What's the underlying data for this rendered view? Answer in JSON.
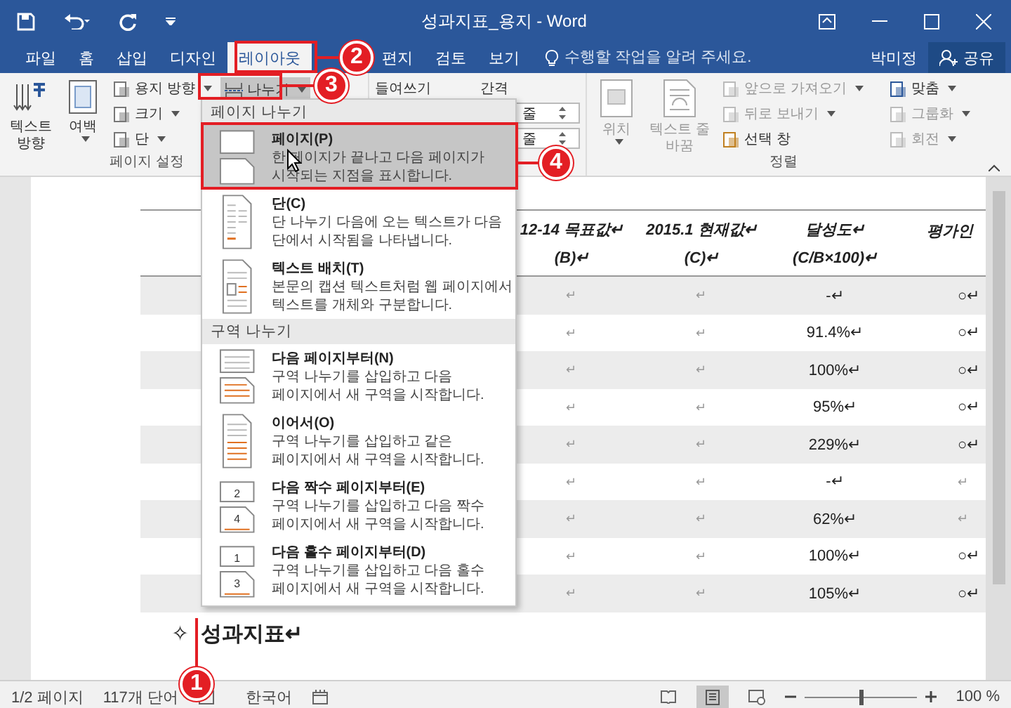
{
  "window": {
    "title": "성과지표_용지 - Word"
  },
  "tabs": [
    {
      "label": "파일",
      "selected": false
    },
    {
      "label": "홈",
      "selected": false
    },
    {
      "label": "삽입",
      "selected": false
    },
    {
      "label": "디자인",
      "selected": false
    },
    {
      "label": "레이아웃",
      "selected": true
    },
    {
      "label": "편지",
      "selected": false
    },
    {
      "label": "검토",
      "selected": false
    },
    {
      "label": "보기",
      "selected": false
    }
  ],
  "tell_me": {
    "placeholder": "수행할 작업을 알려 주세요."
  },
  "user": "박미정",
  "share": "공유",
  "ribbon": {
    "page_setup": {
      "title": "페이지 설정",
      "large": [
        {
          "label": "텍스트 방향"
        },
        {
          "label": "여백"
        }
      ],
      "small": [
        {
          "label": "용지 방향"
        },
        {
          "label": "크기"
        },
        {
          "label": "단"
        }
      ],
      "breaks": {
        "label": "나누기",
        "expanded": true
      }
    },
    "paragraph": {
      "indent": "들여쓰기",
      "spacing": "간격",
      "fields": [
        {
          "value": "줄"
        },
        {
          "value": "줄"
        }
      ]
    },
    "arrange": {
      "title": "정렬",
      "large": [
        {
          "label": "위치",
          "disabled": true
        },
        {
          "label": "텍스트 줄 바꿈",
          "disabled": true
        }
      ],
      "small": [
        {
          "label": "앞으로 가져오기",
          "disabled": true
        },
        {
          "label": "뒤로 보내기",
          "disabled": true
        },
        {
          "label": "선택 창",
          "disabled": false
        },
        {
          "label": "맞춤",
          "disabled": false
        },
        {
          "label": "그룹화",
          "disabled": true
        },
        {
          "label": "회전",
          "disabled": true
        }
      ]
    }
  },
  "breaks_menu": {
    "sections": [
      {
        "title": "페이지 나누기",
        "items": [
          {
            "kind": "page",
            "title": "페이지(P)",
            "description": [
              "한 페이지가 끝나고 다음 페이지가",
              "시작되는 지점을 표시합니다."
            ],
            "selected": true
          },
          {
            "kind": "column",
            "title": "단(C)",
            "description": [
              "단 나누기 다음에 오는 텍스트가 다음",
              "단에서 시작됨을 나타냅니다."
            ],
            "selected": false
          },
          {
            "kind": "wrap",
            "title": "텍스트 배치(T)",
            "description": [
              "본문의 캡션 텍스트처럼 웹 페이지에서",
              "텍스트를 개체와 구분합니다."
            ],
            "selected": false
          }
        ]
      },
      {
        "title": "구역 나누기",
        "items": [
          {
            "kind": "next",
            "title": "다음 페이지부터(N)",
            "description": [
              "구역 나누기를 삽입하고 다음",
              "페이지에서 새 구역을 시작합니다."
            ],
            "selected": false
          },
          {
            "kind": "continuous",
            "title": "이어서(O)",
            "description": [
              "구역 나누기를 삽입하고 같은",
              "페이지에서 새 구역을 시작합니다."
            ],
            "selected": false
          },
          {
            "kind": "numbered",
            "title": "다음 짝수 페이지부터(E)",
            "description": [
              "구역 나누기를 삽입하고 다음 짝수",
              "페이지에서 새 구역을 시작합니다."
            ],
            "page_numbers": [
              "2",
              "4"
            ],
            "selected": false
          },
          {
            "kind": "numbered",
            "title": "다음 홀수 페이지부터(D)",
            "description": [
              "구역 나누기를 삽입하고 다음 홀수",
              "페이지에서 새 구역을 시작합니다."
            ],
            "page_numbers": [
              "1",
              "3"
            ],
            "selected": false
          }
        ]
      }
    ]
  },
  "table": {
    "columns": [
      {
        "title": "12-14 목표값↵",
        "sub": "(B)↵"
      },
      {
        "title": "2015.1 현재값↵",
        "sub": "(C)↵"
      },
      {
        "title": "달성도↵",
        "sub": "(C/B×100)↵"
      },
      {
        "title": "평가인"
      }
    ],
    "rows": [
      [
        "↵",
        "↵",
        "-↵",
        "○↵"
      ],
      [
        "↵",
        "↵",
        "91.4%↵",
        "○↵"
      ],
      [
        "↵",
        "↵",
        "100%↵",
        "○↵"
      ],
      [
        "↵",
        "↵",
        "95%↵",
        "○↵"
      ],
      [
        "↵",
        "↵",
        "229%↵",
        "○↵"
      ],
      [
        "↵",
        "↵",
        "-↵",
        "↵"
      ],
      [
        "↵",
        "↵",
        "62%↵",
        "↵"
      ],
      [
        "↵",
        "↵",
        "100%↵",
        "○↵"
      ],
      [
        "↵",
        "↵",
        "105%↵",
        "○↵"
      ]
    ]
  },
  "heading": {
    "marker": "✧",
    "text": "성과지표↵"
  },
  "status_bar": {
    "page": "1/2 페이지",
    "words": "117개 단어",
    "language": "한국어",
    "zoom": "100 %",
    "zoom_level": {
      "level": 0.5
    }
  },
  "callouts": [
    {
      "number": "1"
    },
    {
      "number": "2"
    },
    {
      "number": "3"
    },
    {
      "number": "4"
    }
  ]
}
